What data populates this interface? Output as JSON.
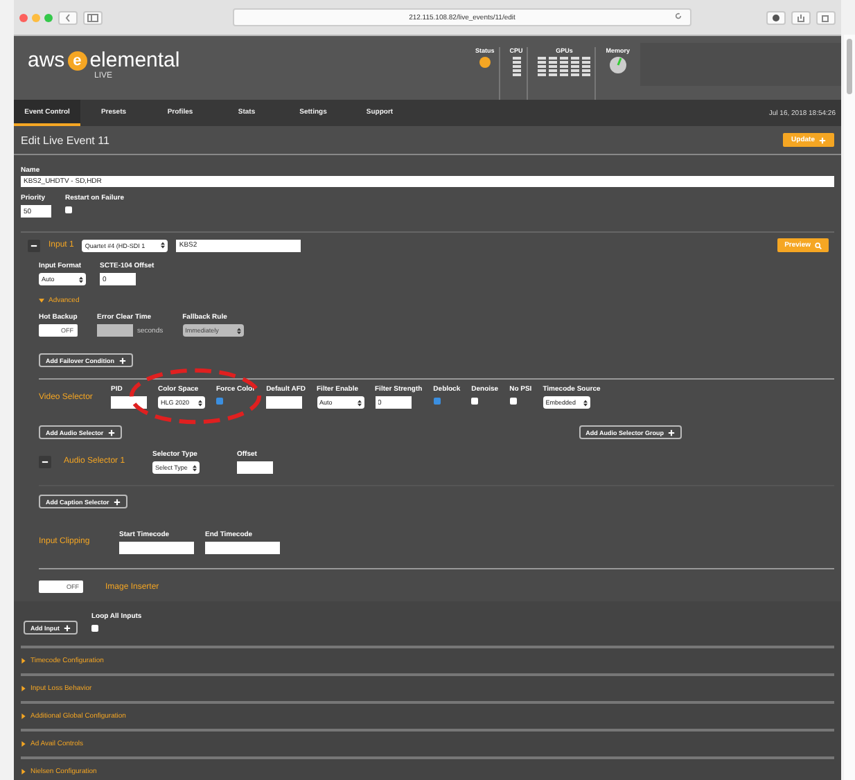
{
  "browser": {
    "url": "212.115.108.82/live_events/11/edit"
  },
  "header": {
    "logo": {
      "prefix": "aws",
      "mark": "e",
      "name": "elemental",
      "product": "LIVE"
    },
    "monitors": [
      {
        "label": "Status",
        "kind": "dot"
      },
      {
        "label": "CPU",
        "kind": "meter"
      },
      {
        "label": "GPUs",
        "kind": "meters"
      },
      {
        "label": "Memory",
        "kind": "gauge"
      }
    ]
  },
  "nav": {
    "tabs": [
      {
        "label": "Event Control",
        "selected": true
      },
      {
        "label": "Presets",
        "selected": false
      },
      {
        "label": "Profiles",
        "selected": false
      },
      {
        "label": "Stats",
        "selected": false
      },
      {
        "label": "Settings",
        "selected": false
      },
      {
        "label": "Support",
        "selected": false
      }
    ],
    "datetime": "Jul 16, 2018 18:54:26"
  },
  "title": "Edit Live Event 11",
  "update_button": "Update",
  "name_field": {
    "label": "Name",
    "value": "KBS2_UHDTV - SD,HDR"
  },
  "priority": {
    "label": "Priority",
    "value": "50"
  },
  "restart_on_failure": {
    "label": "Restart on Failure",
    "checked": false
  },
  "input": {
    "title": "Input 1",
    "expanded": true,
    "source": "Quartet #4 (HD-SDI 1",
    "stream": "KBS2",
    "preview_button": "Preview",
    "format_fields": [
      {
        "label": "Input Format",
        "kind": "select",
        "value": "Auto"
      },
      {
        "label": "SCTE-104 Offset",
        "kind": "input",
        "value": "0"
      }
    ],
    "advanced": {
      "label": "Advanced",
      "expanded": true
    },
    "advanced_fields": [
      {
        "label": "Hot Backup",
        "kind": "toggle",
        "value": "OFF",
        "on": false
      },
      {
        "label": "Error Clear Time",
        "kind": "disabled-input",
        "unit": "seconds"
      },
      {
        "label": "Fallback Rule",
        "kind": "disabled-select",
        "value": "Immediately"
      }
    ],
    "add_failover_button": "Add Failover Condition",
    "video_selector": {
      "title": "Video Selector",
      "fields": [
        {
          "label": "PID",
          "kind": "input"
        },
        {
          "label": "Color Space",
          "kind": "select",
          "value": "HLG 2020"
        },
        {
          "label": "Force Color",
          "kind": "checkbox",
          "checked": true
        },
        {
          "label": "Default AFD",
          "kind": "input"
        },
        {
          "label": "Filter Enable",
          "kind": "select",
          "value": "Auto"
        },
        {
          "label": "Filter Strength",
          "kind": "input",
          "value": "0"
        },
        {
          "label": "Deblock",
          "kind": "checkbox",
          "checked": true
        },
        {
          "label": "Denoise",
          "kind": "checkbox",
          "checked": false
        },
        {
          "label": "No PSI",
          "kind": "checkbox",
          "checked": false
        },
        {
          "label": "Timecode Source",
          "kind": "select",
          "value": "Embedded"
        }
      ]
    },
    "add_audio_selector_button": "Add Audio Selector",
    "add_audio_group_button": "Add Audio Selector Group",
    "audio_selector": {
      "title": "Audio Selector 1",
      "expanded": true,
      "fields": [
        {
          "label": "Selector Type",
          "kind": "select",
          "value": "Select Type"
        },
        {
          "label": "Offset",
          "kind": "input"
        }
      ]
    },
    "add_caption_button": "Add Caption Selector",
    "input_clipping": {
      "title": "Input Clipping",
      "fields": [
        {
          "label": "Start Timecode",
          "kind": "input"
        },
        {
          "label": "End Timecode",
          "kind": "input"
        }
      ]
    },
    "image_inserter": {
      "toggle": "OFF",
      "on": false,
      "label": "Image Inserter"
    }
  },
  "add_input_button": "Add Input",
  "loop_all_inputs": {
    "label": "Loop All Inputs",
    "checked": false
  },
  "sections": [
    {
      "label": "Timecode Configuration",
      "expanded": false
    },
    {
      "label": "Input Loss Behavior",
      "expanded": false
    },
    {
      "label": "Additional Global Configuration",
      "expanded": false
    },
    {
      "label": "Ad Avail Controls",
      "expanded": false
    },
    {
      "label": "Nielsen Configuration",
      "expanded": false
    }
  ]
}
